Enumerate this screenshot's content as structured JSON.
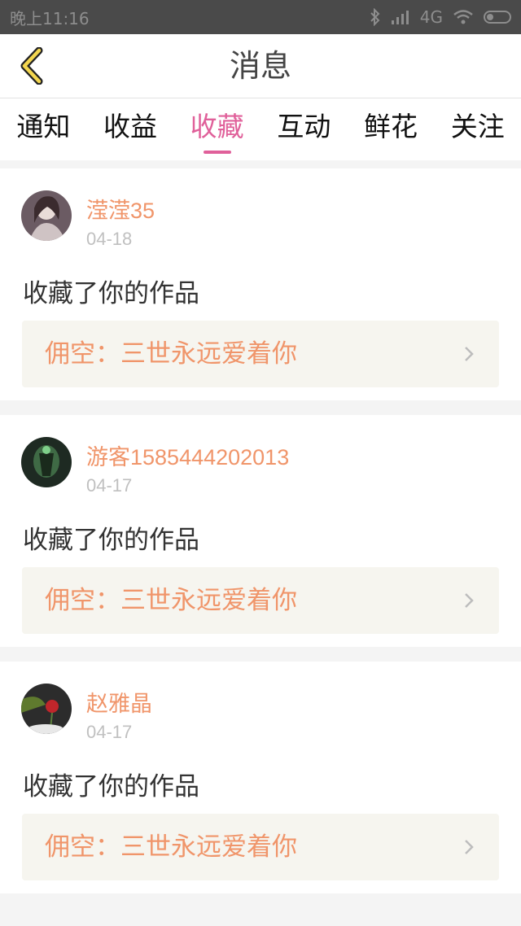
{
  "status_bar": {
    "time": "晚上11:16",
    "network": "4G"
  },
  "header": {
    "title": "消息"
  },
  "tabs": [
    {
      "label": "通知"
    },
    {
      "label": "收益"
    },
    {
      "label": "收藏",
      "active": true
    },
    {
      "label": "互动"
    },
    {
      "label": "鲜花"
    },
    {
      "label": "关注"
    }
  ],
  "messages": [
    {
      "username": "滢滢35",
      "date": "04-18",
      "action": "收藏了你的作品",
      "work": "佣空：三世永远爱着你"
    },
    {
      "username": "游客1585444202013",
      "date": "04-17",
      "action": "收藏了你的作品",
      "work": "佣空：三世永远爱着你"
    },
    {
      "username": "赵雅晶",
      "date": "04-17",
      "action": "收藏了你的作品",
      "work": "佣空：三世永远爱着你"
    }
  ],
  "colors": {
    "accent": "#e0609a",
    "username": "#f0956a",
    "back_arrow": "#f3d64f"
  }
}
